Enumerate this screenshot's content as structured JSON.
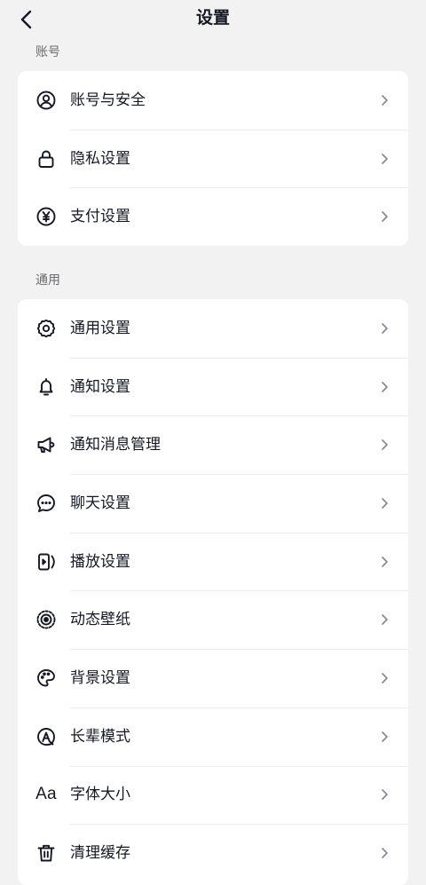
{
  "header": {
    "title": "设置",
    "back_icon": "chevron-left-icon"
  },
  "sections": [
    {
      "label": "账号",
      "items": [
        {
          "label": "账号与安全",
          "icon": "user-circle-icon"
        },
        {
          "label": "隐私设置",
          "icon": "lock-icon"
        },
        {
          "label": "支付设置",
          "icon": "yen-circle-icon"
        }
      ]
    },
    {
      "label": "通用",
      "items": [
        {
          "label": "通用设置",
          "icon": "gear-icon"
        },
        {
          "label": "通知设置",
          "icon": "bell-icon"
        },
        {
          "label": "通知消息管理",
          "icon": "megaphone-icon"
        },
        {
          "label": "聊天设置",
          "icon": "chat-bubble-icon"
        },
        {
          "label": "播放设置",
          "icon": "play-box-icon"
        },
        {
          "label": "动态壁纸",
          "icon": "live-wallpaper-icon"
        },
        {
          "label": "背景设置",
          "icon": "palette-icon"
        },
        {
          "label": "长辈模式",
          "icon": "elder-mode-icon"
        },
        {
          "label": "字体大小",
          "icon": "font-size-icon",
          "icon_text": "Aa"
        },
        {
          "label": "清理缓存",
          "icon": "trash-icon"
        }
      ]
    }
  ],
  "colors": {
    "background": "#f2f2f2",
    "card": "#ffffff",
    "text_primary": "#161823",
    "text_secondary": "#6b6b70",
    "chevron": "#8a8b91",
    "divider": "#ececec"
  }
}
